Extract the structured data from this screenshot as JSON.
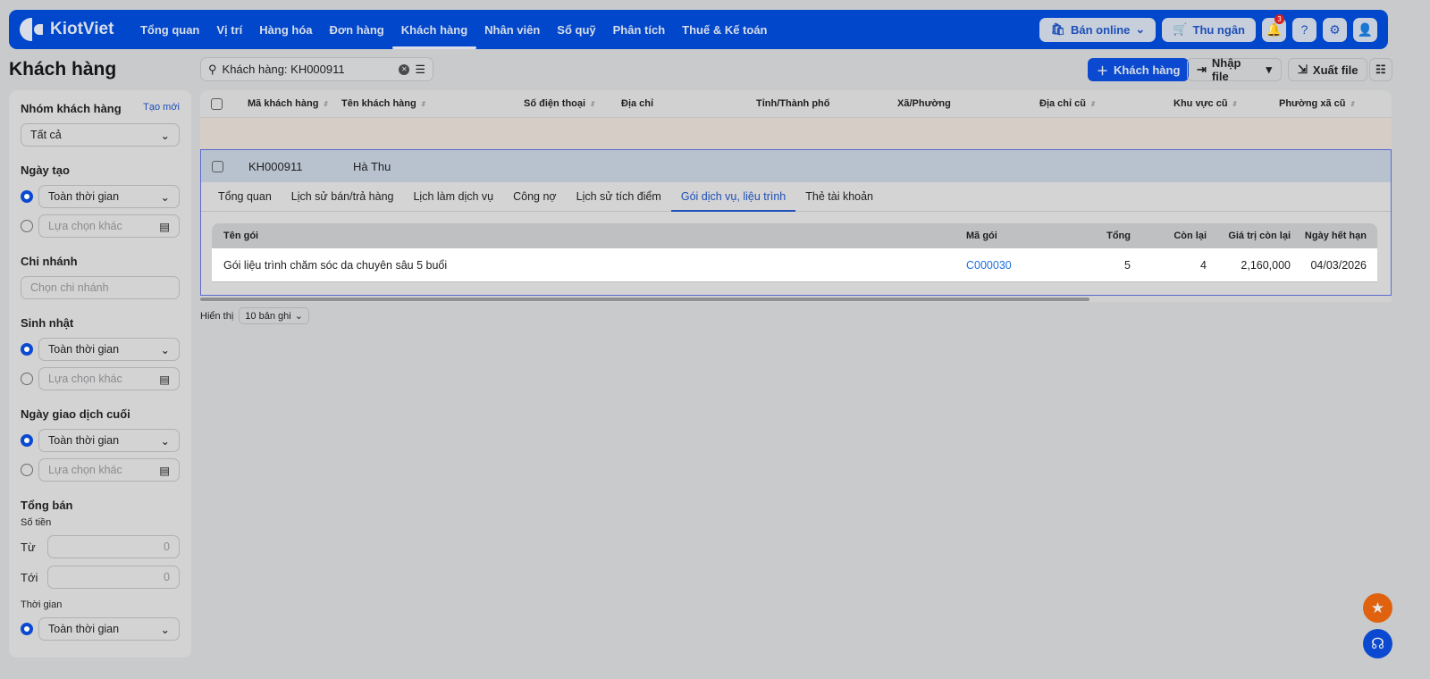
{
  "app": {
    "logo": "KiotViet"
  },
  "nav": [
    "Tổng quan",
    "Vị trí",
    "Hàng hóa",
    "Đơn hàng",
    "Khách hàng",
    "Nhân viên",
    "Sổ quỹ",
    "Phân tích",
    "Thuế & Kế toán"
  ],
  "nav_active": "Khách hàng",
  "topbar": {
    "online": "Bán online",
    "cashier": "Thu ngân",
    "notifications": "3"
  },
  "page": {
    "title": "Khách hàng"
  },
  "search": {
    "value": "Khách hàng: KH000911"
  },
  "actions": {
    "add": "Khách hàng",
    "import": "Nhập file",
    "export": "Xuất file"
  },
  "sidebar": {
    "group": {
      "label": "Nhóm khách hàng",
      "create": "Tạo mới",
      "value": "Tất cả"
    },
    "created": {
      "label": "Ngày tạo",
      "all": "Toàn thời gian",
      "other": "Lựa chọn khác"
    },
    "branch": {
      "label": "Chi nhánh",
      "placeholder": "Chọn chi nhánh"
    },
    "birthday": {
      "label": "Sinh nhật",
      "all": "Toàn thời gian",
      "other": "Lựa chọn khác"
    },
    "last_tx": {
      "label": "Ngày giao dịch cuối",
      "all": "Toàn thời gian",
      "other": "Lựa chọn khác"
    },
    "total": {
      "label": "Tổng bán",
      "amount": "Số tiền",
      "from": "Từ",
      "from_value": "0",
      "to": "Tới",
      "to_value": "0",
      "time": "Thời gian",
      "time_value": "Toàn thời gian"
    }
  },
  "table": {
    "headers": [
      "Mã khách hàng",
      "Tên khách hàng",
      "Số điện thoại",
      "Địa chỉ",
      "Tỉnh/Thành phố",
      "Xã/Phường",
      "Địa chỉ cũ",
      "Khu vực cũ",
      "Phường xã cũ"
    ],
    "row": {
      "code": "KH000911",
      "name": "Hà Thu"
    }
  },
  "detail": {
    "tabs": [
      "Tổng quan",
      "Lịch sử bán/trả hàng",
      "Lịch làm dịch vụ",
      "Công nợ",
      "Lịch sử tích điểm",
      "Gói dịch vụ, liệu trình",
      "Thẻ tài khoản"
    ],
    "active_tab": "Gói dịch vụ, liệu trình",
    "headers": [
      "Tên gói",
      "Mã gói",
      "Tổng",
      "Còn lại",
      "Giá trị còn lại",
      "Ngày hết hạn"
    ],
    "row": {
      "name": "Gói liệu trình chăm sóc da chuyên sâu 5 buổi",
      "code": "C000030",
      "total": "5",
      "remaining": "4",
      "value": "2,160,000",
      "expiry": "04/03/2026"
    }
  },
  "pagination": {
    "label": "Hiển thị",
    "value": "10 bản ghi"
  },
  "colors": {
    "brand": "#0047cc",
    "link": "#1d6fe0",
    "fab_star": "#e0620e"
  }
}
